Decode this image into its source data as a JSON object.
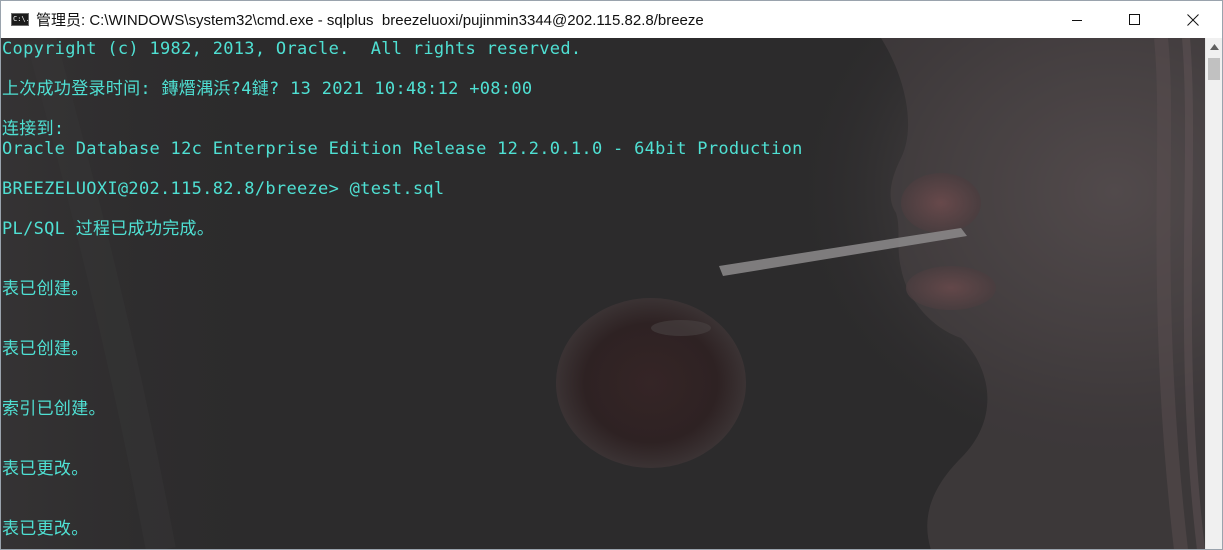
{
  "window": {
    "title": "管理员: C:\\WINDOWS\\system32\\cmd.exe - sqlplus  breezeluoxi/pujinmin3344@202.115.82.8/breeze",
    "icon_name": "cmd-icon",
    "icon_text": "C:\\."
  },
  "controls": {
    "minimize": "minimize-icon",
    "maximize": "maximize-icon",
    "close": "close-icon"
  },
  "console": {
    "text_color": "#4fe0d3",
    "lines": {
      "copyright": "Copyright (c) 1982, 2013, Oracle.  All rights reserved.",
      "last_login": "上次成功登录时间: 鏄熸湡浜?4鏈? 13 2021 10:48:12 +08:00",
      "connected_to": "连接到:",
      "db_version": "Oracle Database 12c Enterprise Edition Release 12.2.0.1.0 - 64bit Production",
      "prompt": "BREEZELUOXI@202.115.82.8/breeze> @test.sql",
      "plsql_done": "PL/SQL 过程已成功完成。",
      "table_created_1": "表已创建。",
      "table_created_2": "表已创建。",
      "index_created": "索引已创建。",
      "table_altered_1": "表已更改。",
      "table_altered_2": "表已更改。"
    }
  }
}
